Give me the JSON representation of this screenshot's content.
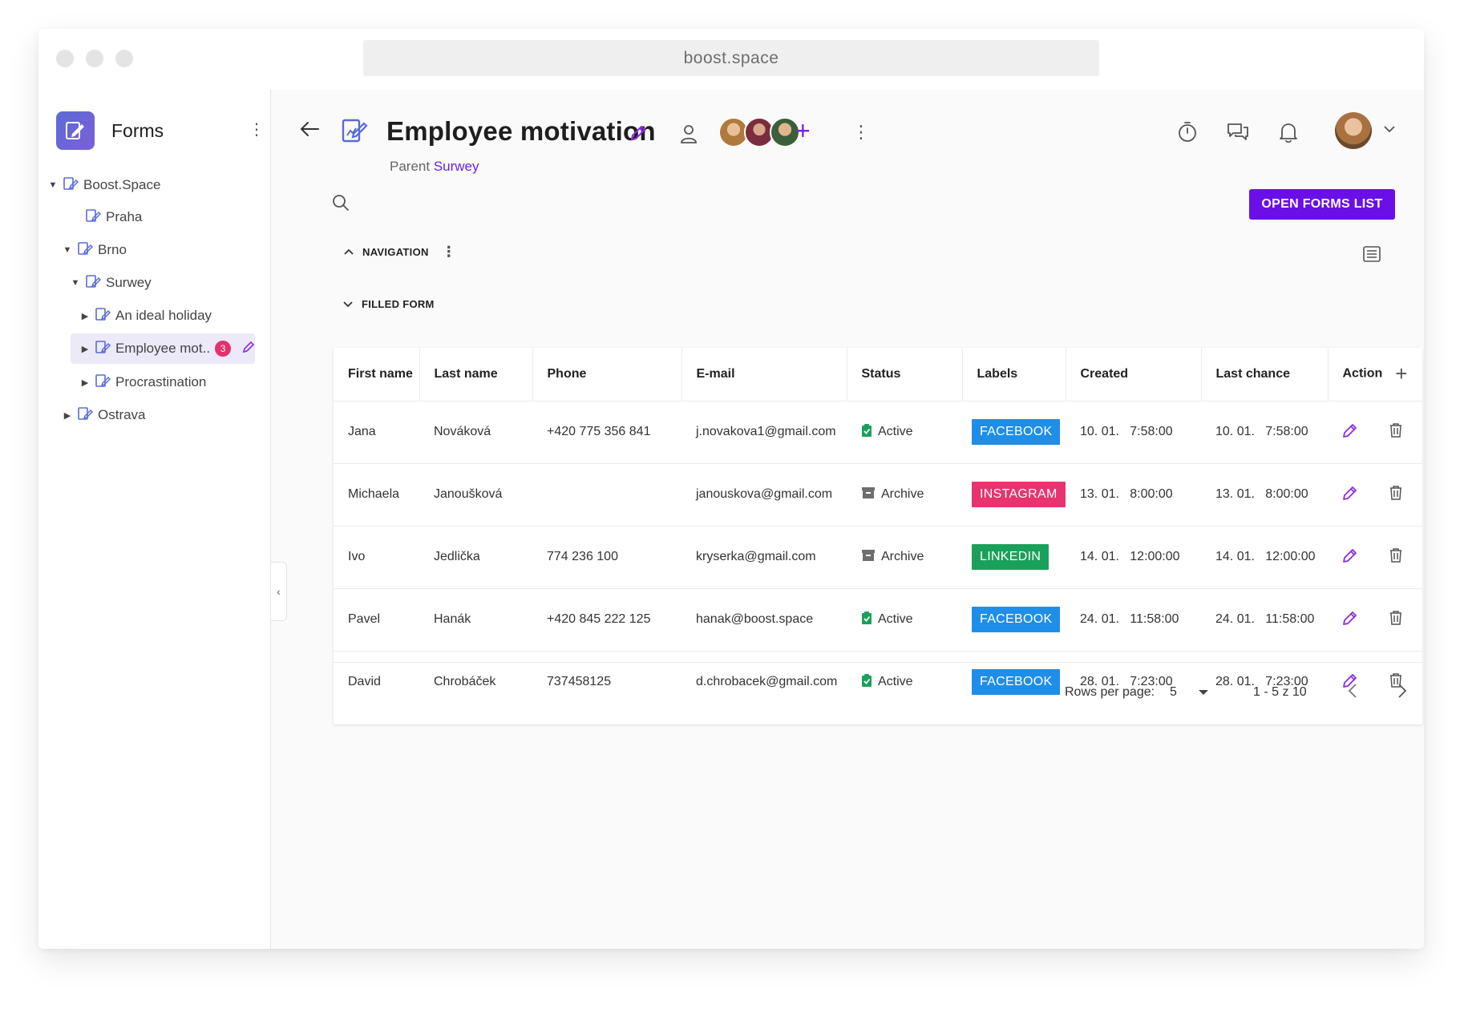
{
  "browser": {
    "url": "boost.space"
  },
  "sidebar": {
    "app_title": "Forms",
    "tree": [
      {
        "label": "Boost.Space",
        "caret": "down"
      },
      {
        "label": "Praha",
        "caret": ""
      },
      {
        "label": "Brno",
        "caret": "down"
      },
      {
        "label": "Surwey",
        "caret": "down"
      },
      {
        "label": "An ideal holiday",
        "caret": "right"
      },
      {
        "label": "Employee mot..",
        "caret": "right",
        "badge": "3"
      },
      {
        "label": "Procrastination",
        "caret": "right"
      },
      {
        "label": "Ostrava",
        "caret": "right"
      }
    ]
  },
  "header": {
    "title": "Employee motivation",
    "parent_prefix": "Parent",
    "parent_link": "Surwey",
    "add_member": "+",
    "open_list_button": "OPEN FORMS LIST"
  },
  "sections": {
    "navigation": "NAVIGATION",
    "filled_form": "FILLED FORM"
  },
  "table": {
    "columns": [
      "First name",
      "Last name",
      "Phone",
      "E-mail",
      "Status",
      "Labels",
      "Created",
      "Last chance",
      "Action"
    ],
    "add_column": "+",
    "rows": [
      {
        "first": "Jana",
        "last": "Nováková",
        "phone": "+420 775 356 841",
        "email": "j.novakova1@gmail.com",
        "status": "Active",
        "label": "FACEBOOK",
        "created": "10. 01.   7:58:00",
        "last_chance": "10. 01.   7:58:00"
      },
      {
        "first": "Michaela",
        "last": "Janoušková",
        "phone": "",
        "email": "janouskova@gmail.com",
        "status": "Archive",
        "label": "INSTAGRAM",
        "created": "13. 01.   8:00:00",
        "last_chance": "13. 01.   8:00:00"
      },
      {
        "first": "Ivo",
        "last": "Jedlička",
        "phone": "774 236 100",
        "email": "kryserka@gmail.com",
        "status": "Archive",
        "label": "LINKEDIN",
        "created": "14. 01.   12:00:00",
        "last_chance": "14. 01.   12:00:00"
      },
      {
        "first": "Pavel",
        "last": "Hanák",
        "phone": "+420 845 222 125",
        "email": "hanak@boost.space",
        "status": "Active",
        "label": "FACEBOOK",
        "created": "24. 01.   11:58:00",
        "last_chance": "24. 01.   11:58:00"
      },
      {
        "first": "David",
        "last": "Chrobáček",
        "phone": "737458125",
        "email": "d.chrobacek@gmail.com",
        "status": "Active",
        "label": "FACEBOOK",
        "created": "28. 01.   7:23:00",
        "last_chance": "28. 01.   7:23:00"
      }
    ]
  },
  "pagination": {
    "rows_per_page_label": "Rows per page:",
    "rows_per_page_value": "5",
    "range": "1 - 5 z 10"
  },
  "colors": {
    "accent": "#6a0fe8",
    "facebook": "#1e8ee8",
    "instagram": "#e8336f",
    "linkedin": "#1aa05a",
    "active": "#1aa05a",
    "archive": "#6e6e6e"
  },
  "icons": {
    "label_colors": {
      "FACEBOOK": "#1e8ee8",
      "INSTAGRAM": "#e8336f",
      "LINKEDIN": "#1aa05a"
    }
  }
}
